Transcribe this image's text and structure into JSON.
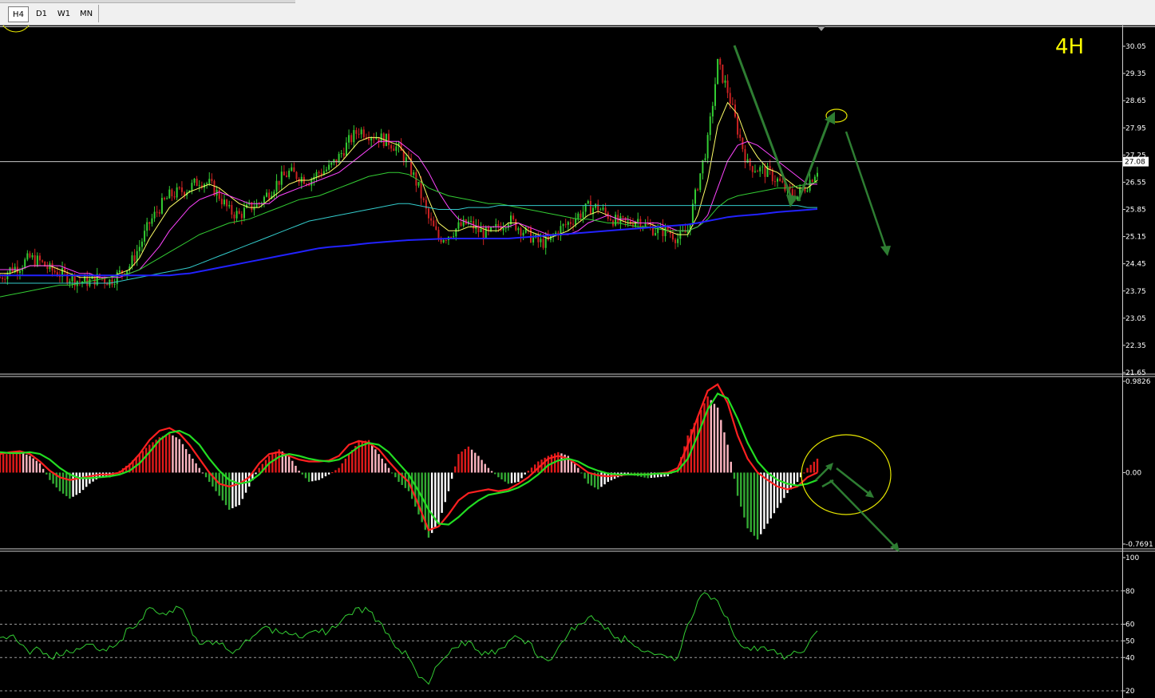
{
  "toolbar": {
    "timeframes": [
      "H4",
      "D1",
      "W1",
      "MN"
    ],
    "active": "H4"
  },
  "main_label": "4H",
  "price_box": "27.08",
  "chart_data": [
    {
      "type": "candlestick",
      "panel": "price",
      "y_ticks": [
        "30.05",
        "29.35",
        "28.65",
        "27.95",
        "27.25",
        "26.55",
        "25.85",
        "25.15",
        "24.45",
        "23.75",
        "23.05",
        "22.35",
        "21.65"
      ],
      "ylim": [
        21.65,
        30.35
      ],
      "current_price": 27.08,
      "close_path": [
        24.1,
        24.3,
        24.4,
        24.6,
        24.5,
        24.3,
        24.2,
        24.1,
        24.0,
        24.0,
        24.1,
        24.0,
        24.2,
        24.4,
        24.9,
        25.5,
        25.9,
        26.2,
        26.3,
        26.4,
        26.6,
        26.5,
        26.2,
        25.8,
        25.7,
        25.9,
        26.0,
        26.3,
        26.6,
        26.8,
        26.7,
        26.6,
        26.8,
        26.9,
        27.2,
        27.6,
        27.9,
        27.8,
        27.7,
        27.6,
        27.4,
        27.0,
        26.4,
        25.6,
        25.1,
        25.2,
        25.4,
        25.5,
        25.3,
        25.2,
        25.4,
        25.6,
        25.4,
        25.2,
        25.0,
        25.0,
        25.3,
        25.5,
        25.7,
        25.9,
        25.9,
        25.7,
        25.5,
        25.5,
        25.6,
        25.4,
        25.3,
        25.3,
        25.1,
        25.3,
        26.5,
        27.6,
        29.6,
        28.9,
        27.9,
        27.0,
        26.9,
        26.8,
        26.6,
        26.3,
        26.2,
        26.5,
        26.9
      ],
      "moving_averages": [
        {
          "color": "#ffff66",
          "values": [
            24.2,
            24.2,
            24.3,
            24.4,
            24.4,
            24.4,
            24.3,
            24.2,
            24.1,
            24.1,
            24.1,
            24.1,
            24.2,
            24.3,
            24.6,
            25.1,
            25.5,
            25.9,
            26.1,
            26.3,
            26.4,
            26.5,
            26.4,
            26.2,
            26.0,
            25.9,
            25.9,
            26.1,
            26.3,
            26.5,
            26.6,
            26.6,
            26.7,
            26.8,
            27.0,
            27.3,
            27.6,
            27.7,
            27.7,
            27.6,
            27.5,
            27.2,
            26.8,
            26.1,
            25.5,
            25.3,
            25.3,
            25.4,
            25.4,
            25.3,
            25.3,
            25.5,
            25.5,
            25.3,
            25.2,
            25.1,
            25.2,
            25.3,
            25.5,
            25.7,
            25.8,
            25.7,
            25.6,
            25.5,
            25.5,
            25.5,
            25.4,
            25.3,
            25.2,
            25.2,
            25.7,
            26.6,
            28.0,
            28.6,
            28.3,
            27.6,
            27.2,
            26.9,
            26.8,
            26.6,
            26.4,
            26.4,
            26.6
          ]
        },
        {
          "color": "#ff44ff",
          "values": [
            24.3,
            24.3,
            24.3,
            24.4,
            24.4,
            24.4,
            24.4,
            24.3,
            24.2,
            24.2,
            24.1,
            24.1,
            24.1,
            24.2,
            24.3,
            24.6,
            24.9,
            25.3,
            25.6,
            25.9,
            26.1,
            26.2,
            26.3,
            26.2,
            26.1,
            26.0,
            26.0,
            26.0,
            26.2,
            26.3,
            26.4,
            26.5,
            26.6,
            26.7,
            26.8,
            27.0,
            27.2,
            27.4,
            27.6,
            27.6,
            27.6,
            27.4,
            27.2,
            26.8,
            26.3,
            25.9,
            25.6,
            25.5,
            25.4,
            25.4,
            25.4,
            25.4,
            25.5,
            25.4,
            25.3,
            25.2,
            25.2,
            25.2,
            25.3,
            25.5,
            25.6,
            25.7,
            25.6,
            25.6,
            25.5,
            25.5,
            25.5,
            25.4,
            25.3,
            25.3,
            25.4,
            25.7,
            26.4,
            27.1,
            27.5,
            27.6,
            27.5,
            27.3,
            27.1,
            26.9,
            26.7,
            26.5,
            26.5
          ]
        },
        {
          "color": "#33cc33",
          "values": [
            23.6,
            23.65,
            23.7,
            23.75,
            23.8,
            23.85,
            23.9,
            23.9,
            23.95,
            24.0,
            24.05,
            24.1,
            24.15,
            24.2,
            24.3,
            24.45,
            24.6,
            24.75,
            24.9,
            25.05,
            25.2,
            25.3,
            25.4,
            25.5,
            25.55,
            25.6,
            25.7,
            25.8,
            25.9,
            26.0,
            26.1,
            26.15,
            26.2,
            26.3,
            26.4,
            26.5,
            26.6,
            26.7,
            26.75,
            26.8,
            26.8,
            26.75,
            26.6,
            26.4,
            26.3,
            26.2,
            26.15,
            26.1,
            26.05,
            26.0,
            26.0,
            25.95,
            25.9,
            25.85,
            25.8,
            25.75,
            25.7,
            25.65,
            25.6,
            25.6,
            25.55,
            25.5,
            25.5,
            25.45,
            25.4,
            25.4,
            25.35,
            25.3,
            25.3,
            25.3,
            25.4,
            25.6,
            25.9,
            26.1,
            26.2,
            26.25,
            26.3,
            26.35,
            26.4,
            26.4,
            26.45,
            26.5,
            26.55
          ]
        },
        {
          "color": "#33cccc",
          "values": [
            23.95,
            23.95,
            23.95,
            23.95,
            23.95,
            23.95,
            23.95,
            23.95,
            23.95,
            23.95,
            23.95,
            23.95,
            24.0,
            24.05,
            24.1,
            24.15,
            24.2,
            24.25,
            24.3,
            24.35,
            24.45,
            24.55,
            24.65,
            24.75,
            24.85,
            24.95,
            25.05,
            25.15,
            25.25,
            25.35,
            25.45,
            25.55,
            25.6,
            25.65,
            25.7,
            25.75,
            25.8,
            25.85,
            25.9,
            25.95,
            26.0,
            26.0,
            25.95,
            25.9,
            25.85,
            25.85,
            25.85,
            25.9,
            25.9,
            25.9,
            25.95,
            25.95,
            25.95,
            25.95,
            25.95,
            25.95,
            25.95,
            25.95,
            25.95,
            25.95,
            25.95,
            25.95,
            25.95,
            25.95,
            25.95,
            25.95,
            25.95,
            25.95,
            25.95,
            25.95,
            25.95,
            25.95,
            25.95,
            25.95,
            25.95,
            25.95,
            25.95,
            25.95,
            25.95,
            25.95,
            25.95,
            25.9,
            25.9
          ]
        },
        {
          "color": "#2222ff",
          "values": [
            24.15,
            24.15,
            24.15,
            24.15,
            24.15,
            24.15,
            24.15,
            24.15,
            24.15,
            24.15,
            24.15,
            24.15,
            24.15,
            24.15,
            24.15,
            24.15,
            24.15,
            24.15,
            24.18,
            24.2,
            24.25,
            24.3,
            24.35,
            24.4,
            24.45,
            24.5,
            24.55,
            24.6,
            24.65,
            24.7,
            24.75,
            24.8,
            24.85,
            24.88,
            24.9,
            24.92,
            24.95,
            24.98,
            25.0,
            25.02,
            25.04,
            25.06,
            25.07,
            25.08,
            25.09,
            25.1,
            25.1,
            25.1,
            25.1,
            25.1,
            25.1,
            25.1,
            25.12,
            25.14,
            25.16,
            25.18,
            25.2,
            25.22,
            25.24,
            25.26,
            25.28,
            25.3,
            25.32,
            25.34,
            25.36,
            25.38,
            25.4,
            25.42,
            25.44,
            25.46,
            25.5,
            25.55,
            25.6,
            25.65,
            25.68,
            25.7,
            25.72,
            25.75,
            25.78,
            25.8,
            25.82,
            25.84,
            25.86
          ]
        }
      ]
    },
    {
      "type": "histogram",
      "panel": "macd",
      "y_ticks": [
        "0.9826",
        "0.00",
        "-0.7691"
      ],
      "ylim": [
        -0.7691,
        0.9826
      ],
      "histogram": [
        0.2,
        0.2,
        0.22,
        0.18,
        0.1,
        -0.08,
        -0.2,
        -0.28,
        -0.22,
        -0.12,
        -0.05,
        -0.05,
        0.02,
        0.1,
        0.2,
        0.3,
        0.38,
        0.42,
        0.36,
        0.2,
        0.05,
        -0.1,
        -0.25,
        -0.4,
        -0.35,
        -0.15,
        0.05,
        0.18,
        0.25,
        0.18,
        0.02,
        -0.1,
        -0.08,
        -0.02,
        0.05,
        0.2,
        0.33,
        0.35,
        0.2,
        0.05,
        -0.1,
        -0.2,
        -0.45,
        -0.7,
        -0.55,
        -0.2,
        0.2,
        0.28,
        0.18,
        0.05,
        -0.05,
        -0.12,
        -0.1,
        0.02,
        0.12,
        0.18,
        0.22,
        0.18,
        0.05,
        -0.12,
        -0.18,
        -0.1,
        -0.05,
        -0.02,
        -0.04,
        -0.06,
        -0.05,
        -0.04,
        0.05,
        0.4,
        0.6,
        0.82,
        0.7,
        0.3,
        -0.25,
        -0.6,
        -0.72,
        -0.55,
        -0.38,
        -0.22,
        -0.1,
        0.05,
        0.15
      ],
      "fast": [
        0.2,
        0.22,
        0.23,
        0.2,
        0.12,
        0.02,
        -0.05,
        -0.08,
        -0.06,
        -0.04,
        -0.02,
        -0.02,
        0.0,
        0.08,
        0.2,
        0.35,
        0.45,
        0.48,
        0.42,
        0.3,
        0.15,
        0.0,
        -0.12,
        -0.15,
        -0.12,
        -0.05,
        0.1,
        0.2,
        0.22,
        0.18,
        0.14,
        0.12,
        0.12,
        0.13,
        0.18,
        0.3,
        0.34,
        0.32,
        0.25,
        0.12,
        0.0,
        -0.1,
        -0.35,
        -0.62,
        -0.58,
        -0.45,
        -0.3,
        -0.22,
        -0.2,
        -0.18,
        -0.2,
        -0.18,
        -0.12,
        -0.05,
        0.05,
        0.15,
        0.18,
        0.15,
        0.08,
        0.0,
        -0.03,
        -0.04,
        -0.03,
        -0.02,
        -0.02,
        -0.02,
        -0.01,
        0.0,
        0.05,
        0.3,
        0.6,
        0.88,
        0.95,
        0.75,
        0.4,
        0.15,
        0.0,
        -0.08,
        -0.15,
        -0.18,
        -0.15,
        -0.05,
        0.0
      ],
      "signal": [
        0.22,
        0.21,
        0.21,
        0.22,
        0.2,
        0.14,
        0.05,
        -0.02,
        -0.06,
        -0.06,
        -0.05,
        -0.04,
        -0.02,
        0.02,
        0.1,
        0.22,
        0.35,
        0.43,
        0.45,
        0.4,
        0.3,
        0.15,
        0.02,
        -0.08,
        -0.12,
        -0.1,
        -0.02,
        0.1,
        0.17,
        0.2,
        0.18,
        0.15,
        0.13,
        0.12,
        0.14,
        0.2,
        0.28,
        0.32,
        0.3,
        0.22,
        0.1,
        -0.02,
        -0.2,
        -0.4,
        -0.55,
        -0.56,
        -0.48,
        -0.38,
        -0.3,
        -0.24,
        -0.22,
        -0.2,
        -0.16,
        -0.1,
        -0.02,
        0.08,
        0.13,
        0.15,
        0.12,
        0.06,
        0.02,
        -0.01,
        -0.02,
        -0.02,
        -0.02,
        -0.02,
        -0.01,
        -0.01,
        0.02,
        0.15,
        0.4,
        0.68,
        0.85,
        0.8,
        0.58,
        0.32,
        0.12,
        0.0,
        -0.08,
        -0.12,
        -0.14,
        -0.12,
        -0.08
      ]
    },
    {
      "type": "line",
      "panel": "rsi",
      "y_ticks": [
        "100",
        "80",
        "60",
        "50",
        "40",
        "20"
      ],
      "ylim": [
        20,
        100
      ],
      "levels": [
        20,
        40,
        50,
        60,
        80
      ],
      "values": [
        52,
        53,
        48,
        42,
        45,
        40,
        41,
        43,
        45,
        48,
        44,
        47,
        50,
        58,
        62,
        70,
        66,
        68,
        70,
        60,
        48,
        50,
        48,
        44,
        45,
        50,
        56,
        58,
        55,
        54,
        52,
        55,
        55,
        56,
        60,
        66,
        70,
        68,
        62,
        54,
        45,
        40,
        28,
        24,
        36,
        42,
        46,
        50,
        44,
        42,
        45,
        50,
        52,
        50,
        40,
        38,
        46,
        54,
        60,
        64,
        62,
        58,
        52,
        50,
        46,
        44,
        42,
        40,
        40,
        60,
        74,
        78,
        74,
        64,
        50,
        46,
        44,
        44,
        42,
        41,
        43,
        47,
        56
      ]
    }
  ]
}
